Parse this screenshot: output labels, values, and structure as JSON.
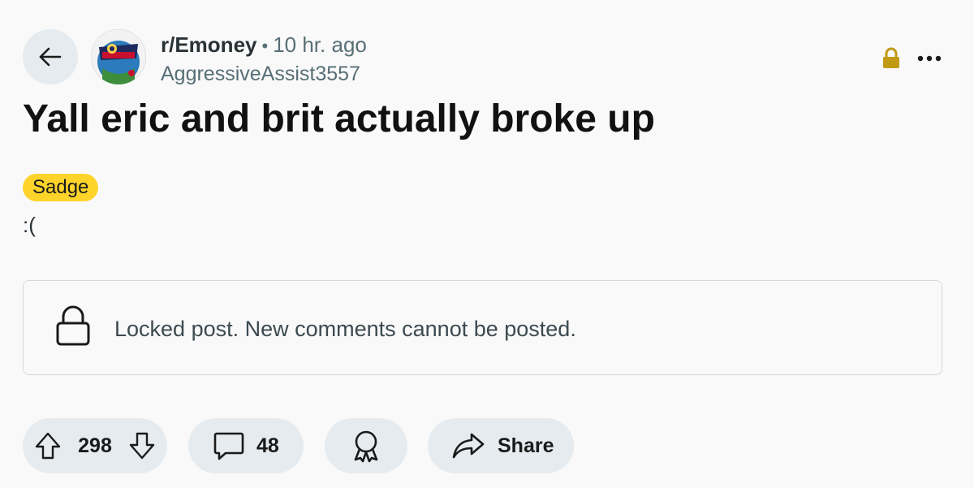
{
  "post": {
    "subreddit": "r/Emoney",
    "separator": "•",
    "time_ago": "10 hr. ago",
    "author": "AggressiveAssist3557",
    "title": "Yall eric and brit actually broke up",
    "flair": "Sadge",
    "body": ":("
  },
  "locked_notice": {
    "text": "Locked post. New comments cannot be posted."
  },
  "actions": {
    "votes": "298",
    "comments": "48",
    "share_label": "Share"
  },
  "colors": {
    "flair_bg": "#fed42b",
    "lock_badge": "#c19a14",
    "pill_bg": "#e5ebee"
  },
  "icons": [
    "back-arrow-icon",
    "lock-icon",
    "more-options-icon",
    "upvote-icon",
    "downvote-icon",
    "comment-icon",
    "award-icon",
    "share-icon"
  ]
}
